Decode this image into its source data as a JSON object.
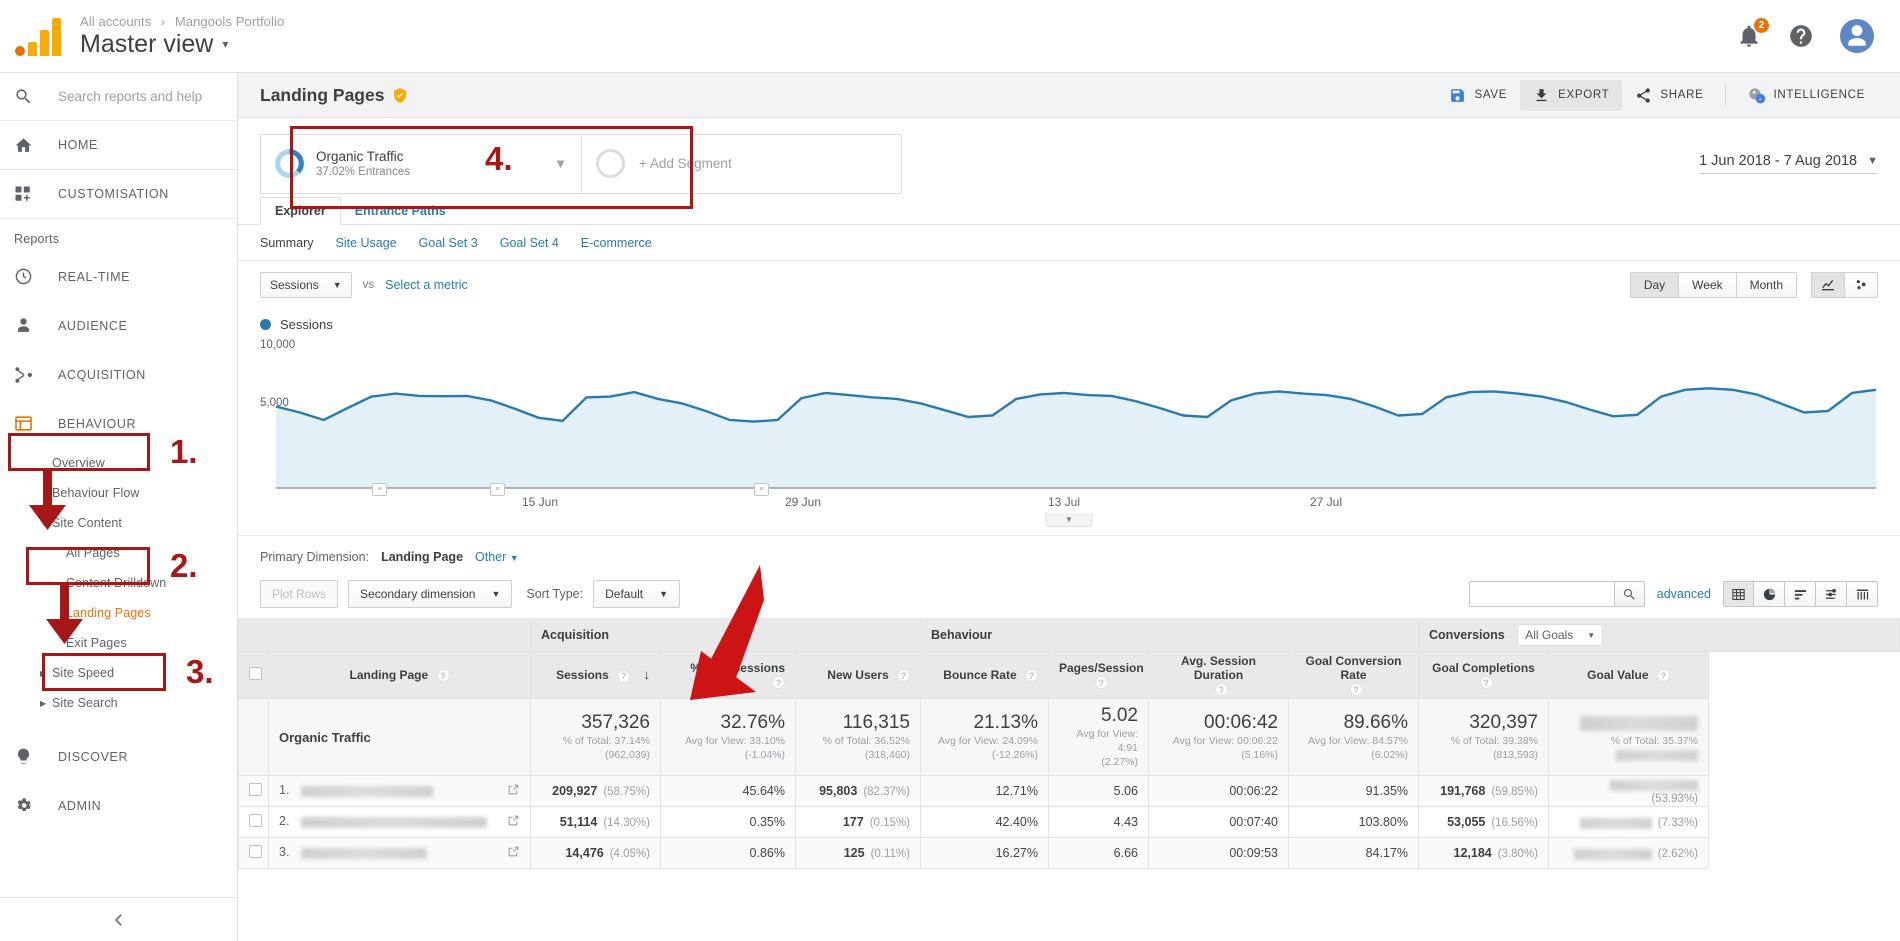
{
  "topbar": {
    "breadcrumb_root": "All accounts",
    "breadcrumb_sep": "›",
    "breadcrumb_account": "Mangools Portfolio",
    "view_name": "Master view",
    "caret": "▾",
    "notification_count": "2",
    "logo_icon": "google-analytics-logo",
    "help_icon": "help-icon",
    "notifications_icon": "bell-icon",
    "avatar_icon": "user-avatar"
  },
  "sidebar": {
    "search_placeholder": "Search reports and help",
    "search_icon": "search-icon",
    "primary": [
      {
        "label": "HOME",
        "icon": "home-icon"
      },
      {
        "label": "CUSTOMISATION",
        "icon": "customisation-icon"
      }
    ],
    "section_label": "Reports",
    "reports": [
      {
        "label": "REAL-TIME",
        "icon": "clock-icon"
      },
      {
        "label": "AUDIENCE",
        "icon": "person-icon"
      },
      {
        "label": "ACQUISITION",
        "icon": "acquisition-icon"
      },
      {
        "label": "BEHAVIOUR",
        "icon": "behaviour-icon"
      }
    ],
    "behaviour_children": [
      {
        "label": "Overview",
        "expandable": false,
        "active": false
      },
      {
        "label": "Behaviour Flow",
        "expandable": false,
        "active": false
      },
      {
        "label": "Site Content",
        "expandable": true,
        "expanded": true,
        "active": false
      },
      {
        "label": "All Pages",
        "level": 2,
        "active": false
      },
      {
        "label": "Content Drilldown",
        "level": 2,
        "active": false
      },
      {
        "label": "Landing Pages",
        "level": 2,
        "active": true
      },
      {
        "label": "Exit Pages",
        "level": 2,
        "active": false
      },
      {
        "label": "Site Speed",
        "expandable": true,
        "expanded": false,
        "active": false
      },
      {
        "label": "Site Search",
        "expandable": true,
        "expanded": false,
        "active": false
      }
    ],
    "bottom": [
      {
        "label": "DISCOVER",
        "icon": "lightbulb-icon"
      },
      {
        "label": "ADMIN",
        "icon": "gear-icon"
      }
    ],
    "collapse_icon": "chevron-left-icon"
  },
  "annotations": {
    "markers": [
      "1.",
      "2.",
      "3.",
      "4."
    ],
    "color": "#a81717"
  },
  "page": {
    "title": "Landing Pages",
    "shield_icon": "shield-check-icon",
    "actions": [
      {
        "label": "SAVE",
        "icon": "save-icon",
        "active": false
      },
      {
        "label": "EXPORT",
        "icon": "export-icon",
        "active": true
      },
      {
        "label": "SHARE",
        "icon": "share-icon",
        "active": false
      },
      {
        "label": "INTELLIGENCE",
        "icon": "intelligence-icon",
        "active": false
      }
    ]
  },
  "segments": {
    "applied": {
      "name": "Organic Traffic",
      "sub": "37.02% Entrances",
      "donut_pct": 37.02
    },
    "add_label": "+ Add Segment",
    "chevron_icon": "chevron-down-icon",
    "date_range": "1 Jun 2018 - 7 Aug 2018"
  },
  "tabs": [
    {
      "label": "Explorer",
      "active": true
    },
    {
      "label": "Entrance Paths",
      "active": false
    }
  ],
  "subtabs": [
    {
      "label": "Summary",
      "active": true
    },
    {
      "label": "Site Usage",
      "active": false
    },
    {
      "label": "Goal Set 3",
      "active": false
    },
    {
      "label": "Goal Set 4",
      "active": false
    },
    {
      "label": "E-commerce",
      "active": false
    }
  ],
  "metric_row": {
    "metric": "Sessions",
    "vs": "vs",
    "select_metric": "Select a metric",
    "granularity": [
      {
        "label": "Day",
        "active": true
      },
      {
        "label": "Week",
        "active": false
      },
      {
        "label": "Month",
        "active": false
      }
    ],
    "chart_type_icons": [
      "line-chart-icon",
      "scatter-chart-icon"
    ]
  },
  "chart_data": {
    "type": "area",
    "title": "Sessions",
    "series_name": "Sessions",
    "series_color": "#2a7ab0",
    "fill_color": "#e3f0f8",
    "ylabel": "",
    "xlabel": "",
    "ylim": [
      0,
      10000
    ],
    "ytick_labels": [
      "10,000",
      "5,000"
    ],
    "ytick_values": [
      10000,
      5000
    ],
    "xtick_labels": [
      "15 Jun",
      "29 Jun",
      "13 Jul",
      "27 Jul"
    ],
    "xtick_positions": [
      14,
      28,
      42,
      56
    ],
    "x_start": "1 Jun 2018",
    "x_end": "7 Aug 2018",
    "grid": false,
    "legend_position": "top-left",
    "annotations_markers": 3,
    "values": [
      5400,
      5000,
      4500,
      5300,
      6050,
      6250,
      6100,
      6080,
      6100,
      5800,
      5250,
      4650,
      4450,
      6000,
      6050,
      6350,
      5900,
      5600,
      5100,
      4500,
      4400,
      4500,
      5950,
      6300,
      6150,
      6000,
      5900,
      5600,
      5150,
      4700,
      4800,
      5900,
      6200,
      6300,
      6150,
      6100,
      5750,
      5300,
      4800,
      4700,
      5800,
      6250,
      6400,
      6250,
      6150,
      5900,
      5400,
      4800,
      4900,
      6000,
      6350,
      6400,
      6250,
      6050,
      5700,
      5200,
      4750,
      4850,
      6050,
      6500,
      6600,
      6500,
      6200,
      5600,
      5000,
      5100,
      6300,
      6500
    ]
  },
  "primary_dimension": {
    "label": "Primary Dimension:",
    "value": "Landing Page",
    "other": "Other",
    "caret": "▾"
  },
  "table_tools": {
    "plot_rows": "Plot Rows",
    "secondary_dimension": "Secondary dimension",
    "sort_type_label": "Sort Type:",
    "sort_type_value": "Default",
    "search_value": "",
    "search_icon": "search-icon",
    "advanced": "advanced",
    "view_icons": [
      "table-view-icon",
      "pie-view-icon",
      "performance-view-icon",
      "comparison-view-icon",
      "pivot-view-icon"
    ]
  },
  "table": {
    "groups": [
      {
        "label": "",
        "span": 2
      },
      {
        "label": "Acquisition",
        "span": 3
      },
      {
        "label": "Behaviour",
        "span": 4
      },
      {
        "label": "Conversions",
        "span": 3,
        "dropdown": "All Goals"
      }
    ],
    "columns": [
      {
        "label": "Landing Page",
        "align": "left",
        "help": true,
        "sorted": false
      },
      {
        "label": "Sessions",
        "align": "right",
        "help": true,
        "sorted": true,
        "sort_dir": "desc"
      },
      {
        "label": "% New Sessions",
        "align": "right",
        "help": true
      },
      {
        "label": "New Users",
        "align": "right",
        "help": true
      },
      {
        "label": "Bounce Rate",
        "align": "right",
        "help": true
      },
      {
        "label": "Pages/Session",
        "align": "center",
        "help": true
      },
      {
        "label": "Avg. Session Duration",
        "align": "center",
        "help": true
      },
      {
        "label": "Goal Conversion Rate",
        "align": "center",
        "help": true
      },
      {
        "label": "Goal Completions",
        "align": "center",
        "help": true
      },
      {
        "label": "Goal Value",
        "align": "center",
        "help": true
      }
    ],
    "summary_row": {
      "name": "Organic Traffic",
      "cells": [
        {
          "value": "357,326",
          "line2": "% of Total: 37.14%",
          "line3": "(962,039)"
        },
        {
          "value": "32.76%",
          "line2": "Avg for View: 33.10%",
          "line3": "(-1.04%)"
        },
        {
          "value": "116,315",
          "line2": "% of Total: 36.52%",
          "line3": "(318,460)"
        },
        {
          "value": "21.13%",
          "line2": "Avg for View: 24.09%",
          "line3": "(-12.26%)"
        },
        {
          "value": "5.02",
          "line2": "Avg for View: 4.91",
          "line3": "(2.27%)"
        },
        {
          "value": "00:06:42",
          "line2": "Avg for View: 00:06:22",
          "line3": "(5.16%)"
        },
        {
          "value": "89.66%",
          "line2": "Avg for View: 84.57%",
          "line3": "(6.02%)"
        },
        {
          "value": "320,397",
          "line2": "% of Total: 39.38%",
          "line3": "(813,593)"
        },
        {
          "value": "",
          "redacted": true,
          "line2": "% of Total: 35.37%",
          "line3": "",
          "line3_redacted": true
        }
      ]
    },
    "rows": [
      {
        "rank": "1.",
        "landing_page": "",
        "landing_page_redacted": true,
        "redacted_width": 132,
        "sessions": "209,927",
        "sessions_pct": "(58.75%)",
        "new_sessions_pct": "45.64%",
        "new_users": "95,803",
        "new_users_pct": "(82.37%)",
        "bounce_rate": "12.71%",
        "pages_session": "5.06",
        "avg_duration": "00:06:22",
        "goal_conv_rate": "91.35%",
        "goal_completions": "191,768",
        "goal_completions_pct": "(59.85%)",
        "goal_value": "",
        "goal_value_redacted": true,
        "goal_value_pct": "(53.93%)"
      },
      {
        "rank": "2.",
        "landing_page": "",
        "landing_page_redacted": true,
        "redacted_width": 186,
        "sessions": "51,114",
        "sessions_pct": "(14.30%)",
        "new_sessions_pct": "0.35%",
        "new_users": "177",
        "new_users_pct": "(0.15%)",
        "bounce_rate": "42.40%",
        "pages_session": "4.43",
        "avg_duration": "00:07:40",
        "goal_conv_rate": "103.80%",
        "goal_completions": "53,055",
        "goal_completions_pct": "(16.56%)",
        "goal_value": "",
        "goal_value_redacted": true,
        "goal_value_pct": "(7.33%)"
      },
      {
        "rank": "3.",
        "landing_page": "",
        "landing_page_redacted": true,
        "redacted_width": 126,
        "sessions": "14,476",
        "sessions_pct": "(4.05%)",
        "new_sessions_pct": "0.86%",
        "new_users": "125",
        "new_users_pct": "(0.11%)",
        "bounce_rate": "16.27%",
        "pages_session": "6.66",
        "avg_duration": "00:09:53",
        "goal_conv_rate": "84.17%",
        "goal_completions": "12,184",
        "goal_completions_pct": "(3.80%)",
        "goal_value": "",
        "goal_value_redacted": true,
        "goal_value_pct": "(2.62%)"
      }
    ],
    "external_link_icon": "open-in-new-icon"
  }
}
